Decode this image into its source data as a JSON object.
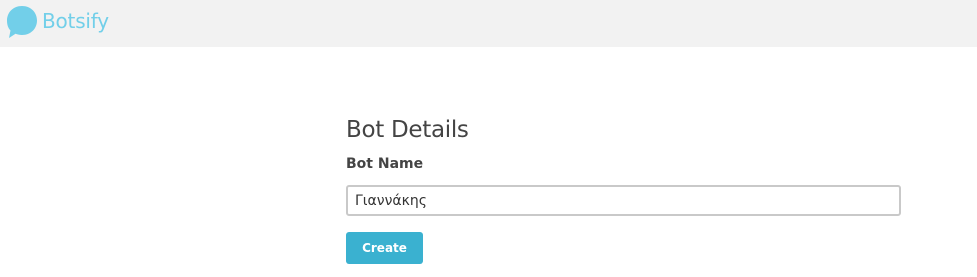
{
  "header": {
    "logo_text": "Botsify",
    "logo_icon": "speech-bubble-icon",
    "brand_color": "#72cfe9",
    "background_color": "#f2f2f2"
  },
  "form": {
    "title": "Bot Details",
    "bot_name_label": "Bot Name",
    "bot_name_value": "Γιαννάκης",
    "create_label": "Create",
    "button_color": "#3ab1d0"
  }
}
